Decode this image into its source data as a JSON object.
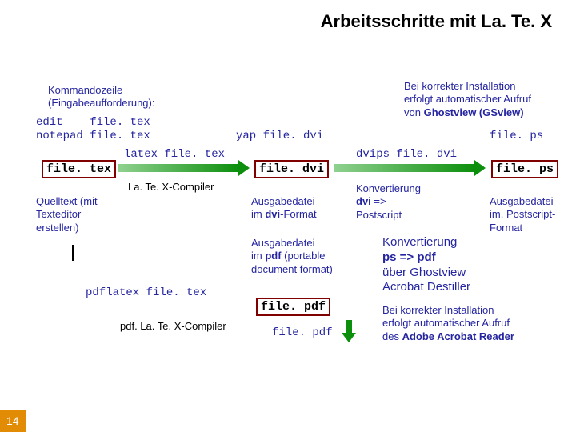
{
  "title": "Arbeitsschritte mit La. Te. X",
  "left": {
    "kommandozeile": "Kommandozeile",
    "eingabe": "(Eingabeaufforderung):",
    "cmd1": "edit    file. tex",
    "cmd2": "notepad file. tex",
    "file_tex": "file. tex",
    "quelltext1": "Quelltext (mit",
    "quelltext2": "Texteditor",
    "quelltext3": "erstellen)"
  },
  "mid": {
    "latex_cmd": "latex file. tex",
    "latex_compiler": "La. Te. X-Compiler",
    "yap_cmd": "yap file. dvi",
    "file_dvi": "file. dvi",
    "ausgabe_dvi1": "Ausgabedatei",
    "ausgabe_dvi2_a": "im ",
    "ausgabe_dvi2_b": "dvi",
    "ausgabe_dvi2_c": "-Format",
    "ausgabe_pdf1": "Ausgabedatei",
    "ausgabe_pdf2_a": "im ",
    "ausgabe_pdf2_b": "pdf",
    "ausgabe_pdf2_c": " (portable",
    "ausgabe_pdf3": "document format)",
    "pdflatex_cmd": "pdflatex file. tex",
    "pdf_compiler": "pdf. La. Te. X-Compiler",
    "file_pdf": "file. pdf",
    "file_pdf2": "file. pdf"
  },
  "right": {
    "install1": "Bei korrekter Installation",
    "install2": "erfolgt automatischer Aufruf",
    "install3_a": "von ",
    "install3_b": "Ghostview (GSview)",
    "file_ps_cmd": "file. ps",
    "dvips_cmd": "dvips file. dvi",
    "file_ps": "file. ps",
    "konv1": "Konvertierung",
    "konv2_a": "dvi",
    "konv2_b": " => ",
    "konv3": "Postscript",
    "ausgabe_ps1": "Ausgabedatei",
    "ausgabe_ps2": "im. Postscript-",
    "ausgabe_ps3": "Format",
    "konv_pdf1": "Konvertierung",
    "konv_pdf2": "ps => pdf",
    "konv_pdf3": "über Ghostview",
    "konv_pdf4": "Acrobat Destiller",
    "acro1": "Bei korrekter Installation",
    "acro2": "erfolgt automatischer Aufruf",
    "acro3_a": "des ",
    "acro3_b": "Adobe Acrobat Reader"
  },
  "slide": "14"
}
